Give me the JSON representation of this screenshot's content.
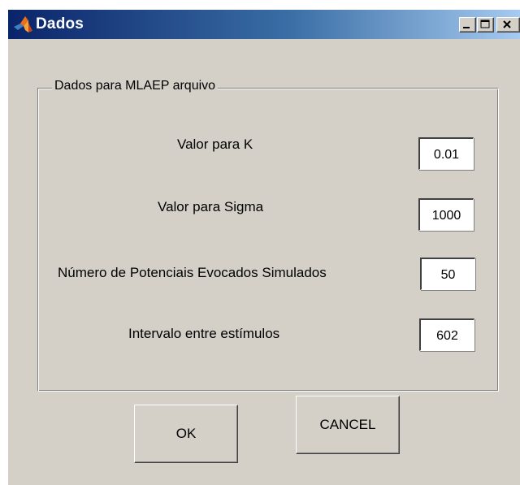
{
  "window": {
    "title": "Dados",
    "title_bar_colors": [
      "#0a246a",
      "#3a6ea5",
      "#a6caf0"
    ],
    "background_color": "#d4d0c8",
    "app_icon": "matlab-logo-icon",
    "controls": {
      "minimize_icon": "minimize-icon",
      "maximize_icon": "maximize-icon",
      "close_icon": "close-icon"
    }
  },
  "group": {
    "label": "Dados para MLAEP arquivo"
  },
  "fields": [
    {
      "label": "Valor para K",
      "value": "0.01"
    },
    {
      "label": "Valor para Sigma",
      "value": "1000"
    },
    {
      "label": "Número de Potenciais Evocados Simulados",
      "value": "50"
    },
    {
      "label": "Intervalo entre estímulos",
      "value": "602"
    }
  ],
  "buttons": {
    "ok_label": "OK",
    "cancel_label": "CANCEL"
  }
}
